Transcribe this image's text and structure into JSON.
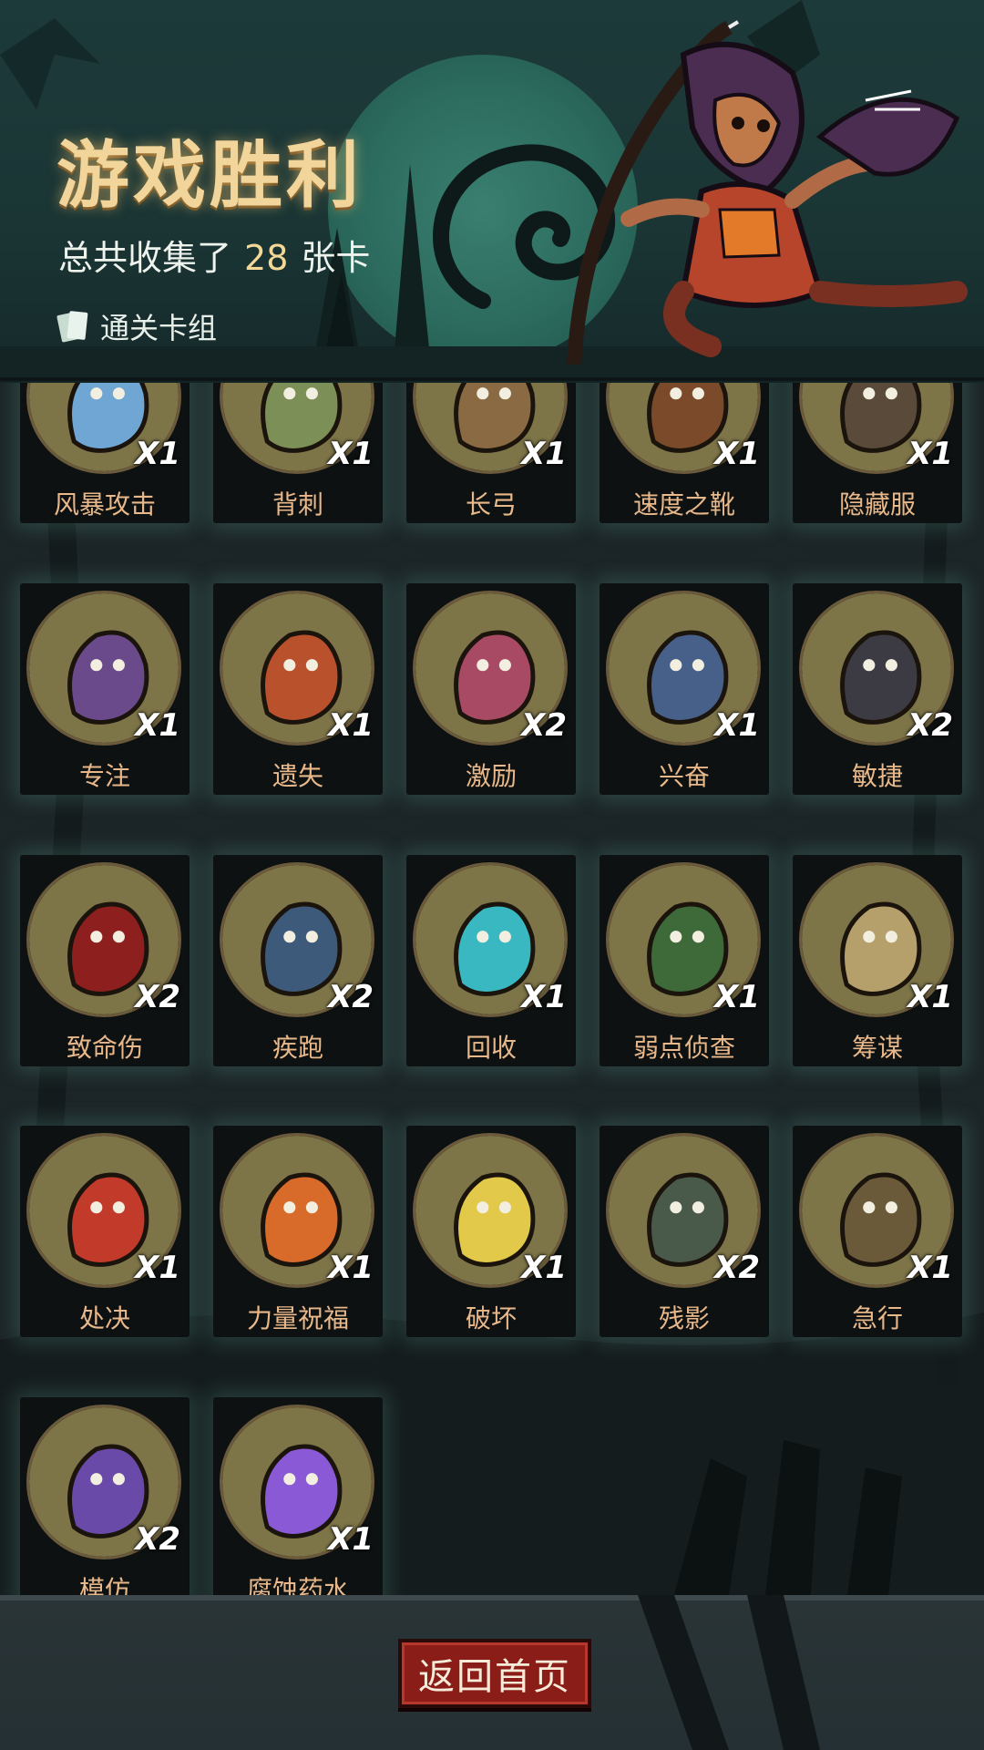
{
  "header": {
    "title": "游戏胜利",
    "summary_prefix": "总共收集了",
    "summary_count": "28",
    "summary_suffix": "张卡",
    "deck_button_label": "通关卡组"
  },
  "cards": [
    {
      "name": "风暴攻击",
      "qty": "X1",
      "art_color": "#6fa6d4",
      "icon": "lightning-burst-icon"
    },
    {
      "name": "背刺",
      "qty": "X1",
      "art_color": "#7b8f56",
      "icon": "goblin-icon"
    },
    {
      "name": "长弓",
      "qty": "X1",
      "art_color": "#8a6a42",
      "icon": "longbow-icon"
    },
    {
      "name": "速度之靴",
      "qty": "X1",
      "art_color": "#7a4a2a",
      "icon": "boot-icon"
    },
    {
      "name": "隐藏服",
      "qty": "X1",
      "art_color": "#5a4a3a",
      "icon": "cloak-icon"
    },
    {
      "name": "专注",
      "qty": "X1",
      "art_color": "#6a4a8a",
      "icon": "wizard-icon"
    },
    {
      "name": "遗失",
      "qty": "X1",
      "art_color": "#b9512c",
      "icon": "pirate-icon"
    },
    {
      "name": "激励",
      "qty": "X2",
      "art_color": "#a84a63",
      "icon": "hammer-ogre-icon"
    },
    {
      "name": "兴奋",
      "qty": "X1",
      "art_color": "#46608a",
      "icon": "dwarf-icon"
    },
    {
      "name": "敏捷",
      "qty": "X2",
      "art_color": "#3c3b44",
      "icon": "panther-icon"
    },
    {
      "name": "致命伤",
      "qty": "X2",
      "art_color": "#8e1f1f",
      "icon": "dagger-blood-icon"
    },
    {
      "name": "疾跑",
      "qty": "X2",
      "art_color": "#3e5a7a",
      "icon": "runner-icon"
    },
    {
      "name": "回收",
      "qty": "X1",
      "art_color": "#3ab8c2",
      "icon": "boomerang-icon"
    },
    {
      "name": "弱点侦查",
      "qty": "X1",
      "art_color": "#3e6a3a",
      "icon": "wolf-icon"
    },
    {
      "name": "筹谋",
      "qty": "X1",
      "art_color": "#b5a06b",
      "icon": "map-icon"
    },
    {
      "name": "处决",
      "qty": "X1",
      "art_color": "#c23a2a",
      "icon": "executioner-icon"
    },
    {
      "name": "力量祝福",
      "qty": "X1",
      "art_color": "#d86a2a",
      "icon": "fist-icon"
    },
    {
      "name": "破坏",
      "qty": "X1",
      "art_color": "#e2c94a",
      "icon": "tool-break-icon"
    },
    {
      "name": "残影",
      "qty": "X2",
      "art_color": "#4a5a4a",
      "icon": "shadow-clones-icon"
    },
    {
      "name": "急行",
      "qty": "X1",
      "art_color": "#6a5a3a",
      "icon": "warrior-rush-icon"
    },
    {
      "name": "模仿",
      "qty": "X2",
      "art_color": "#6a4aa8",
      "icon": "goblin-mimic-icon"
    },
    {
      "name": "腐蚀药水",
      "qty": "X1",
      "art_color": "#8a5ad6",
      "icon": "potion-icon"
    }
  ],
  "footer": {
    "home_button_label": "返回首页"
  }
}
